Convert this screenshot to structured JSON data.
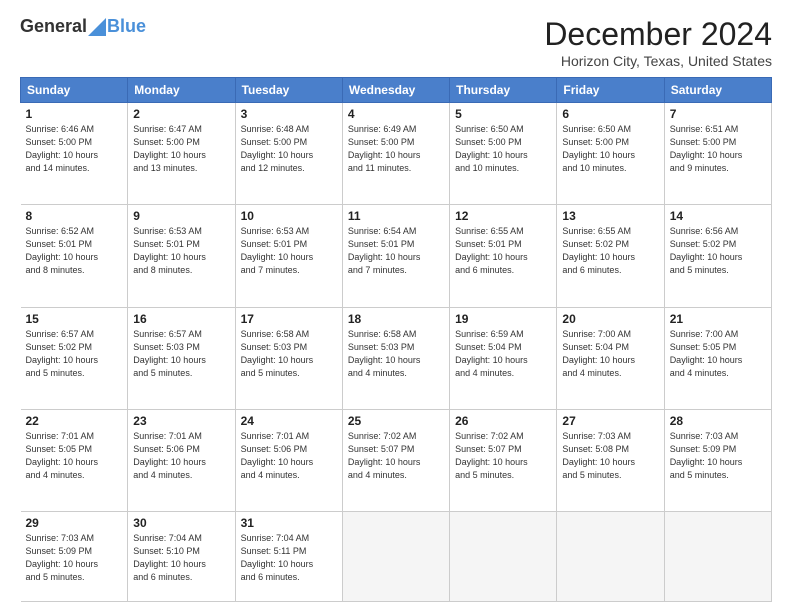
{
  "logo": {
    "general": "General",
    "blue": "Blue"
  },
  "title": "December 2024",
  "location": "Horizon City, Texas, United States",
  "days_of_week": [
    "Sunday",
    "Monday",
    "Tuesday",
    "Wednesday",
    "Thursday",
    "Friday",
    "Saturday"
  ],
  "weeks": [
    [
      {
        "day": "1",
        "info": "Sunrise: 6:46 AM\nSunset: 5:00 PM\nDaylight: 10 hours\nand 14 minutes."
      },
      {
        "day": "2",
        "info": "Sunrise: 6:47 AM\nSunset: 5:00 PM\nDaylight: 10 hours\nand 13 minutes."
      },
      {
        "day": "3",
        "info": "Sunrise: 6:48 AM\nSunset: 5:00 PM\nDaylight: 10 hours\nand 12 minutes."
      },
      {
        "day": "4",
        "info": "Sunrise: 6:49 AM\nSunset: 5:00 PM\nDaylight: 10 hours\nand 11 minutes."
      },
      {
        "day": "5",
        "info": "Sunrise: 6:50 AM\nSunset: 5:00 PM\nDaylight: 10 hours\nand 10 minutes."
      },
      {
        "day": "6",
        "info": "Sunrise: 6:50 AM\nSunset: 5:00 PM\nDaylight: 10 hours\nand 10 minutes."
      },
      {
        "day": "7",
        "info": "Sunrise: 6:51 AM\nSunset: 5:00 PM\nDaylight: 10 hours\nand 9 minutes."
      }
    ],
    [
      {
        "day": "8",
        "info": "Sunrise: 6:52 AM\nSunset: 5:01 PM\nDaylight: 10 hours\nand 8 minutes."
      },
      {
        "day": "9",
        "info": "Sunrise: 6:53 AM\nSunset: 5:01 PM\nDaylight: 10 hours\nand 8 minutes."
      },
      {
        "day": "10",
        "info": "Sunrise: 6:53 AM\nSunset: 5:01 PM\nDaylight: 10 hours\nand 7 minutes."
      },
      {
        "day": "11",
        "info": "Sunrise: 6:54 AM\nSunset: 5:01 PM\nDaylight: 10 hours\nand 7 minutes."
      },
      {
        "day": "12",
        "info": "Sunrise: 6:55 AM\nSunset: 5:01 PM\nDaylight: 10 hours\nand 6 minutes."
      },
      {
        "day": "13",
        "info": "Sunrise: 6:55 AM\nSunset: 5:02 PM\nDaylight: 10 hours\nand 6 minutes."
      },
      {
        "day": "14",
        "info": "Sunrise: 6:56 AM\nSunset: 5:02 PM\nDaylight: 10 hours\nand 5 minutes."
      }
    ],
    [
      {
        "day": "15",
        "info": "Sunrise: 6:57 AM\nSunset: 5:02 PM\nDaylight: 10 hours\nand 5 minutes."
      },
      {
        "day": "16",
        "info": "Sunrise: 6:57 AM\nSunset: 5:03 PM\nDaylight: 10 hours\nand 5 minutes."
      },
      {
        "day": "17",
        "info": "Sunrise: 6:58 AM\nSunset: 5:03 PM\nDaylight: 10 hours\nand 5 minutes."
      },
      {
        "day": "18",
        "info": "Sunrise: 6:58 AM\nSunset: 5:03 PM\nDaylight: 10 hours\nand 4 minutes."
      },
      {
        "day": "19",
        "info": "Sunrise: 6:59 AM\nSunset: 5:04 PM\nDaylight: 10 hours\nand 4 minutes."
      },
      {
        "day": "20",
        "info": "Sunrise: 7:00 AM\nSunset: 5:04 PM\nDaylight: 10 hours\nand 4 minutes."
      },
      {
        "day": "21",
        "info": "Sunrise: 7:00 AM\nSunset: 5:05 PM\nDaylight: 10 hours\nand 4 minutes."
      }
    ],
    [
      {
        "day": "22",
        "info": "Sunrise: 7:01 AM\nSunset: 5:05 PM\nDaylight: 10 hours\nand 4 minutes."
      },
      {
        "day": "23",
        "info": "Sunrise: 7:01 AM\nSunset: 5:06 PM\nDaylight: 10 hours\nand 4 minutes."
      },
      {
        "day": "24",
        "info": "Sunrise: 7:01 AM\nSunset: 5:06 PM\nDaylight: 10 hours\nand 4 minutes."
      },
      {
        "day": "25",
        "info": "Sunrise: 7:02 AM\nSunset: 5:07 PM\nDaylight: 10 hours\nand 4 minutes."
      },
      {
        "day": "26",
        "info": "Sunrise: 7:02 AM\nSunset: 5:07 PM\nDaylight: 10 hours\nand 5 minutes."
      },
      {
        "day": "27",
        "info": "Sunrise: 7:03 AM\nSunset: 5:08 PM\nDaylight: 10 hours\nand 5 minutes."
      },
      {
        "day": "28",
        "info": "Sunrise: 7:03 AM\nSunset: 5:09 PM\nDaylight: 10 hours\nand 5 minutes."
      }
    ],
    [
      {
        "day": "29",
        "info": "Sunrise: 7:03 AM\nSunset: 5:09 PM\nDaylight: 10 hours\nand 5 minutes."
      },
      {
        "day": "30",
        "info": "Sunrise: 7:04 AM\nSunset: 5:10 PM\nDaylight: 10 hours\nand 6 minutes."
      },
      {
        "day": "31",
        "info": "Sunrise: 7:04 AM\nSunset: 5:11 PM\nDaylight: 10 hours\nand 6 minutes."
      },
      {
        "day": "",
        "info": ""
      },
      {
        "day": "",
        "info": ""
      },
      {
        "day": "",
        "info": ""
      },
      {
        "day": "",
        "info": ""
      }
    ]
  ]
}
